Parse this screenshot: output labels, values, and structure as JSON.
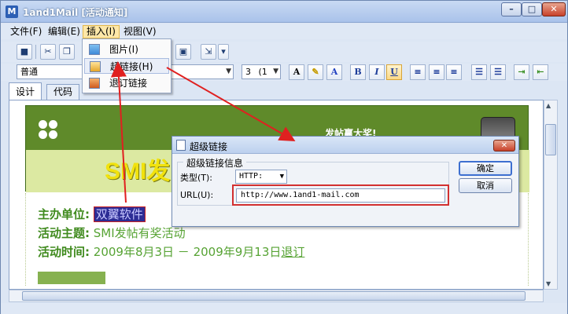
{
  "window": {
    "title": "1and1Mail [活动通知]",
    "app_icon": "M"
  },
  "menus": [
    "文件(F)",
    "编辑(E)",
    "插入(I)",
    "视图(V)"
  ],
  "format": {
    "style": "普通",
    "size": "3",
    "size_suffix": "(1"
  },
  "tabs": [
    "设计",
    "代码"
  ],
  "dropdown": [
    "图片(I)",
    "超链接(H)",
    "退订链接"
  ],
  "banner": {
    "prize": "发帖赢大奖!",
    "headline": "SMI发"
  },
  "info": {
    "org_label": "主办单位:",
    "org_value": "双翼软件",
    "theme_label": "活动主题:",
    "theme_value": "SMI发帖有奖活动",
    "time_label": "活动时间:",
    "time_value": "2009年8月3日 － 2009年9月13日",
    "unsub": "退订"
  },
  "dialog": {
    "title": "超级链接",
    "group": "超级链接信息",
    "type_label": "类型(T):",
    "type_value": "HTTP:",
    "url_label": "URL(U):",
    "url_value": "http://www.1and1-mail.com",
    "ok": "确定",
    "cancel": "取消"
  },
  "colors": {
    "accent": "#d23030",
    "banner": "#5f8a2a",
    "selection": "#2c2c95"
  }
}
